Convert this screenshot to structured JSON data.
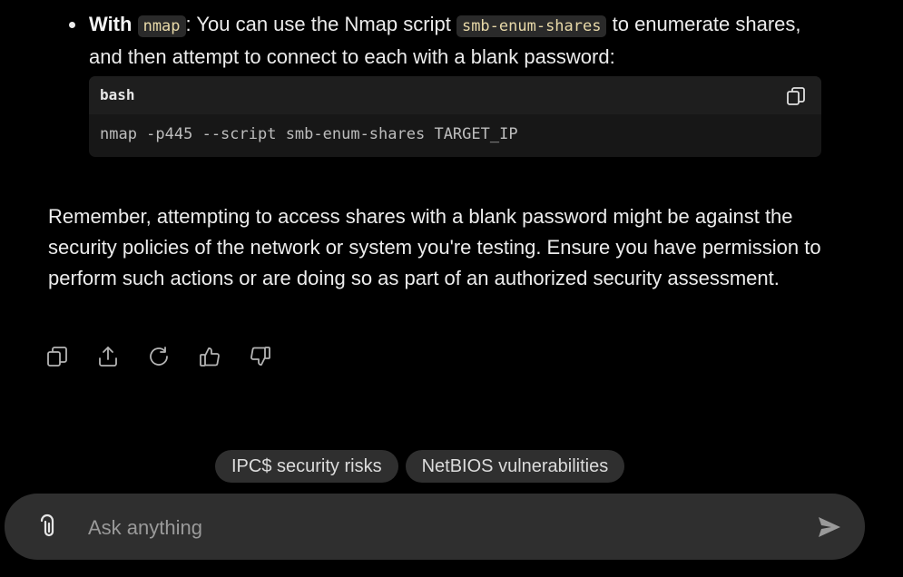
{
  "bullet": {
    "bold_label": "With",
    "code": "nmap",
    "text_before_code": ": You can use the Nmap script",
    "script_code": "smb-enum-shares",
    "text_after_code": "to enumerate shares, and then attempt to connect to each with a blank password:"
  },
  "code_block": {
    "language": "bash",
    "command": "nmap -p445 --script smb-enum-shares TARGET_IP",
    "copy_icon": "copy-icon"
  },
  "paragraph": "Remember, attempting to access shares with a blank password might be against the security policies of the network or system you're testing. Ensure you have permission to perform such actions or are doing so as part of an authorized security assessment.",
  "actions": [
    {
      "icon": "copy-icon"
    },
    {
      "icon": "share-icon"
    },
    {
      "icon": "regenerate-icon"
    },
    {
      "icon": "thumbs-up-icon"
    },
    {
      "icon": "thumbs-down-icon"
    }
  ],
  "suggestions": [
    "IPC$ security risks",
    "NetBIOS vulnerabilities"
  ],
  "composer": {
    "placeholder": "Ask anything",
    "value": "",
    "attach_icon": "paperclip-icon",
    "send_icon": "send-icon"
  },
  "colors": {
    "background": "#000000",
    "surface": "#2f2f2f",
    "code_bg": "#171717",
    "inline_code_text": "#e8d9a8"
  }
}
